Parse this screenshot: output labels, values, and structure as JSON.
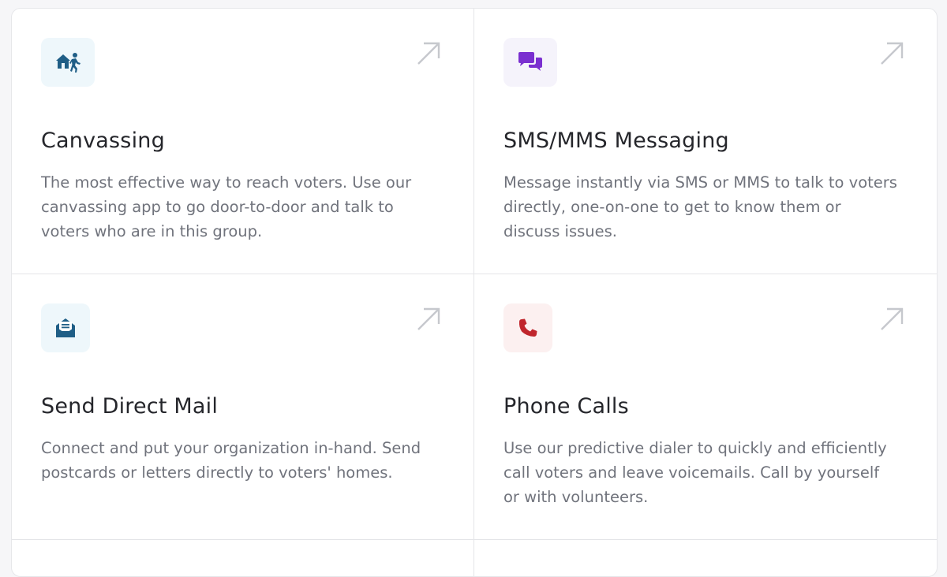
{
  "colors": {
    "canvassing_tile": "#eef7fb",
    "canvassing_icon": "#1f5e86",
    "messaging_tile": "#f5f3fb",
    "messaging_icon": "#7a2fd0",
    "mail_tile": "#eef7fb",
    "mail_icon": "#1f5e86",
    "phone_tile": "#fcf0f0",
    "phone_icon": "#c0262d",
    "arrow": "#c6c8cd"
  },
  "cards": [
    {
      "icon": "door-knocking-person-icon",
      "title": "Canvassing",
      "description": "The most effective way to reach voters. Use our canvassing app to go door-to-door and talk to voters who are in this group."
    },
    {
      "icon": "chat-bubbles-icon",
      "title": "SMS/MMS Messaging",
      "description": "Message instantly via SMS or MMS to talk to voters directly, one-on-one to get to know them or discuss issues."
    },
    {
      "icon": "open-envelope-icon",
      "title": "Send Direct Mail",
      "description": "Connect and put your organization in-hand. Send postcards or letters directly to voters' homes."
    },
    {
      "icon": "phone-icon",
      "title": "Phone Calls",
      "description": "Use our predictive dialer to quickly and efficiently call voters and leave voicemails. Call by yourself or with volunteers."
    }
  ]
}
